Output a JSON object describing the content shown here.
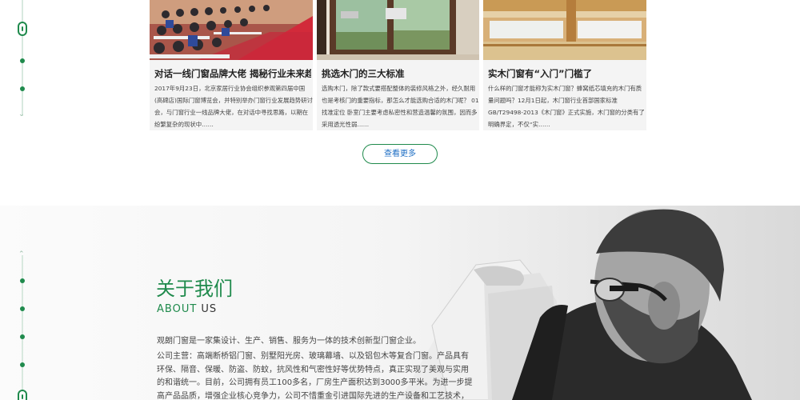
{
  "news": [
    {
      "title": "对话一线门窗品牌大佬 揭秘行业未来趋势",
      "desc": "2017年9月23日，北京家居行业协会组织参观第四届中国(高碑店)国际门窗博览会，并特别举办门窗行业发展趋势研讨会，与门窗行业一线品牌大佬，在对话中寻找思路，以期在纷繁复杂的现状中……"
    },
    {
      "title": "挑选木门的三大标准",
      "desc": "选购木门，除了款式要搭配整体的装修风格之外，经久耐用也是考核门的重要指标，那怎么才能选购合适的木门呢？ 01 找准定位 卧室门主要考虑私密性和营造温馨的氛围，因而多采用透光性弱……"
    },
    {
      "title": "实木门窗有“入门”门槛了",
      "desc": "什么样的门窗才能称为实木门窗？蜂窝纸芯填充的木门有质量问题吗？12月1日起，木门窗行业首部国家标准GB/T29498-2013《木门窗》正式实施，木门窗的分类有了明确界定，不仅“实……"
    }
  ],
  "more_button": "查看更多",
  "about": {
    "title": "关于我们",
    "sub_en_green": "ABOUT",
    "sub_en_dark": "US",
    "intro": "观朗门窗是一家集设计、生产、销售、服务为一体的技术创新型门窗企业。",
    "detail": "公司主营：高端断桥铝门窗、别墅阳光房、玻璃幕墙、以及铝包木等复合门窗。产品具有环保、隔音、保暖、防盗、防蚊，抗风性和气密性好等优势特点，真正实现了美观与实用的和谐统一。目前，公司拥有员工100多名，厂房生产面积达到3000多平米。为进一步提高产品品质，增强企业核心竞争力，公司不惜重金引进国际先进的生产设备和工艺技术，使产品生产达"
  },
  "colors": {
    "accent": "#1f8a4c",
    "link": "#1f6fc4"
  }
}
